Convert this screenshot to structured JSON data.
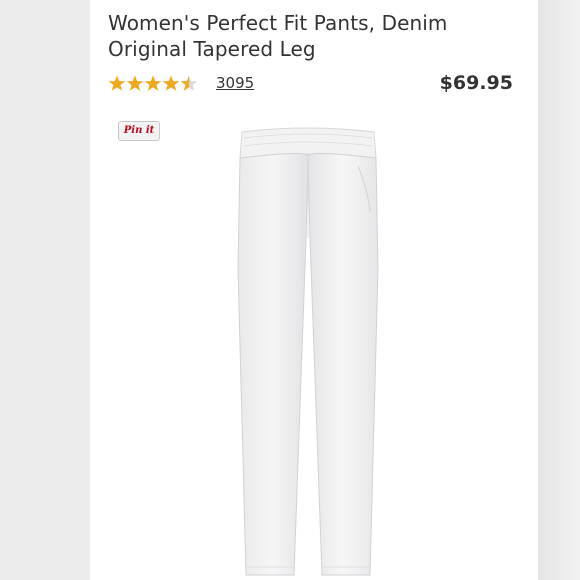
{
  "product": {
    "title_line1": "Women's Perfect Fit Pants, Denim",
    "title_line2": "Original Tapered Leg",
    "rating": 4.5,
    "rating_max": 5,
    "review_count": "3095",
    "price": "$69.95",
    "pin_label": "Pin it",
    "image_icon": "white-pants-photo"
  },
  "colors": {
    "star": "#f0a81c",
    "star_empty": "#d9d9d9",
    "text": "#333333",
    "pin": "#bd081c"
  }
}
